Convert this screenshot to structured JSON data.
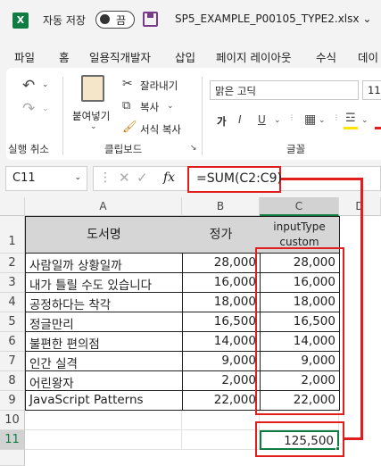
{
  "titlebar": {
    "app_icon": "X",
    "autosave_label": "자동 저장",
    "toggle_state": "끔",
    "filename": "SP5_EXAMPLE_P00105_TYPE2.xlsx"
  },
  "tabs": [
    "파일",
    "홈",
    "페이지 레이아웃",
    "수식",
    "데이"
  ],
  "tabs_named": {
    "file": "파일",
    "home": "홈",
    "macro": "일용직개발자",
    "insert": "삽입",
    "layout": "페이지 레이아웃",
    "formula": "수식",
    "data": "데이"
  },
  "ribbon": {
    "undo_group_label": "실행 취소",
    "paste_label": "붙여넣기",
    "cut_label": "잘라내기",
    "copy_label": "복사",
    "format_painter_label": "서식 복사",
    "clipboard_group_label": "클립보드",
    "font_name": "맑은 고딕",
    "font_size": "11",
    "bold_label": "가",
    "font_group_label": "글꼴"
  },
  "formula_bar": {
    "name_box": "C11",
    "fx": "fx",
    "formula": "=SUM(C2:C9)"
  },
  "columns": [
    "A",
    "B",
    "C",
    "D"
  ],
  "rows": [
    "1",
    "2",
    "3",
    "4",
    "5",
    "6",
    "7",
    "8",
    "9",
    "10",
    "11"
  ],
  "table": {
    "header": {
      "a": "도서명",
      "b": "정가",
      "c": "inputType custom"
    },
    "rows": [
      {
        "a": "사람일까 상황일까",
        "b": "28,000",
        "c": "28,000"
      },
      {
        "a": "내가 틀릴 수도 있습니다",
        "b": "16,000",
        "c": "16,000"
      },
      {
        "a": "공정하다는 착각",
        "b": "18,000",
        "c": "18,000"
      },
      {
        "a": "정글만리",
        "b": "16,500",
        "c": "16,500"
      },
      {
        "a": "불편한 편의점",
        "b": "14,000",
        "c": "14,000"
      },
      {
        "a": "인간 실격",
        "b": "9,000",
        "c": "9,000"
      },
      {
        "a": "어린왕자",
        "b": "2,000",
        "c": "2,000"
      },
      {
        "a": "JavaScript Patterns",
        "b": "22,000",
        "c": "22,000"
      }
    ],
    "total": "125,500"
  },
  "colors": {
    "excel_green": "#107c41",
    "annotation_red": "#e01e1e",
    "header_fill": "#d6d6d6"
  }
}
